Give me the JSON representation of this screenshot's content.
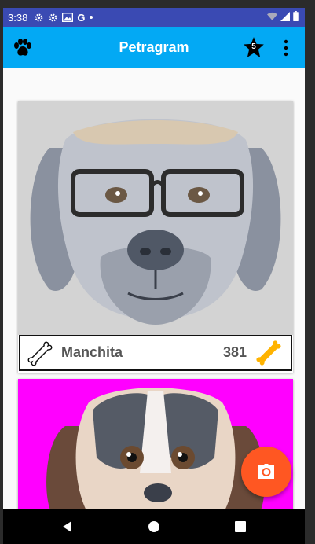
{
  "status_bar": {
    "time": "3:38",
    "notification_icons": [
      "gear-icon",
      "gear-icon",
      "image-icon",
      "google-icon",
      "dot-icon"
    ],
    "right_icons": [
      "wifi-icon",
      "signal-icon",
      "battery-icon"
    ]
  },
  "app_bar": {
    "title": "Petragram",
    "left_icon": "paw-icon",
    "favorites_badge": "5",
    "menu_icon": "more-vert-icon",
    "color": "#03a9f4"
  },
  "pets": [
    {
      "name": "Manchita",
      "likes": "381",
      "photo_bg": "#d3d3d3"
    },
    {
      "photo_bg": "#ff00ff"
    }
  ],
  "fab": {
    "icon": "camera-icon",
    "color": "#ff5722"
  },
  "nav_bar": {
    "buttons": [
      "back-icon",
      "home-icon",
      "recents-icon"
    ]
  }
}
